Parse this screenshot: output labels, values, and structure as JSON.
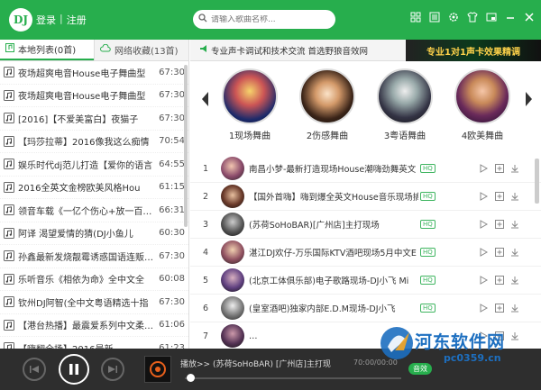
{
  "header": {
    "logo": "DJ",
    "login": "登录",
    "separator": "|",
    "register": "注册",
    "search_placeholder": "请输入歌曲名称..."
  },
  "left": {
    "tab_local": "本地列表(0首)",
    "tab_fav": "网络收藏(13首)",
    "songs": [
      {
        "title": "夜场超爽电音House电子舞曲型",
        "dur": "67:30"
      },
      {
        "title": "夜场超爽电音House电子舞曲型",
        "dur": "67:30"
      },
      {
        "title": "[2016]【不爱美富白】夜猫子",
        "dur": "67:30"
      },
      {
        "title": "【玛莎拉蒂】2016像我这么痴情",
        "dur": "70:54"
      },
      {
        "title": "娱乐时代dj范儿打造【爱你的语言",
        "dur": "64:55"
      },
      {
        "title": "2016全英文金榜欧美风格Hou",
        "dur": "61:15"
      },
      {
        "title": "领音车载《一亿个伤心+放一百…",
        "dur": "66:31"
      },
      {
        "title": "阿译 渴望爱情的猜(DJ小鱼儿",
        "dur": "60:30"
      },
      {
        "title": "孙鑫最新发烧靓霉诱惑国语连贩…",
        "dur": "67:30"
      },
      {
        "title": "乐听音乐《相依为命》全中文全",
        "dur": "60:08"
      },
      {
        "title": "钦州DJ阿智(全中文粤语精选十指",
        "dur": "67:30"
      },
      {
        "title": "【港台热播】最震爱系列中文柔…",
        "dur": "61:06"
      },
      {
        "title": "【嗨翻全场】2016最新…",
        "dur": "61:23"
      }
    ]
  },
  "right": {
    "banner_text": "专业声卡调试和技术交流 首选野狼音效网",
    "banner_ad": "专业1对1声卡效果精调",
    "categories": [
      {
        "label": "1现场舞曲"
      },
      {
        "label": "2伤感舞曲"
      },
      {
        "label": "3粤语舞曲"
      },
      {
        "label": "4欧美舞曲"
      }
    ],
    "hq_label": "HQ",
    "tracks": [
      {
        "num": "1",
        "title": "南昌小梦-最新打造现场House潮嗨劲舞英文"
      },
      {
        "num": "2",
        "title": "【国外首嗨】嗨到爆全英文House音乐现场搞"
      },
      {
        "num": "3",
        "title": "(苏荷SoHoBAR)[广州店]主打现场"
      },
      {
        "num": "4",
        "title": "湛江DJ欢仔-万乐国际KTV酒吧现场5月中文E"
      },
      {
        "num": "5",
        "title": "(北京工体俱乐部)电子歌路现场-DJ小飞 Mi"
      },
      {
        "num": "6",
        "title": "(皇室酒吧)独家内部E.D.M现场-DJ小飞"
      },
      {
        "num": "7",
        "title": "…"
      }
    ]
  },
  "player": {
    "now_playing": "播放>> (苏荷SoHoBAR) [广州店]主打现",
    "time": "70:00/00:00",
    "sound_label": "音效"
  },
  "watermark": {
    "text": "河东软件网",
    "url": "pc0359.cn"
  },
  "colors": {
    "brand": "#27ae4d",
    "player": "#2e2e2e"
  }
}
